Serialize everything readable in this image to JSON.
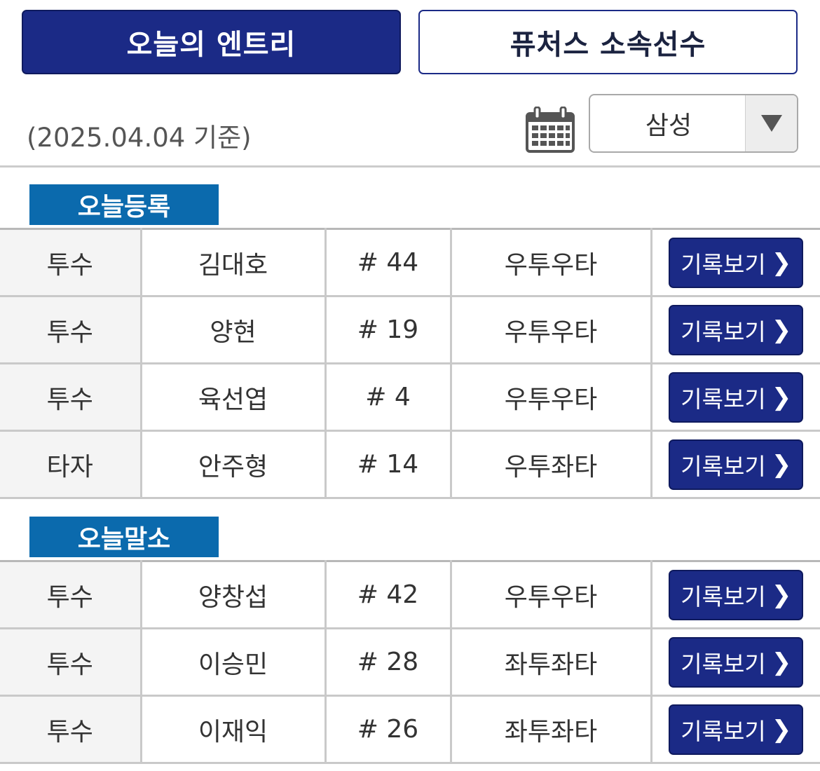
{
  "tabs": [
    {
      "label": "오늘의 엔트리",
      "active": true
    },
    {
      "label": "퓨처스 소속선수",
      "active": false
    }
  ],
  "date_note": "(2025.04.04 기준)",
  "team_select": {
    "value": "삼성"
  },
  "colors": {
    "accent": "#1b2a86",
    "section": "#0b6aad"
  },
  "sections": [
    {
      "title": "오늘등록",
      "rows": [
        {
          "position": "투수",
          "name": "김대호",
          "number": "# 44",
          "hand": "우투우타",
          "button": "기록보기"
        },
        {
          "position": "투수",
          "name": "양현",
          "number": "# 19",
          "hand": "우투우타",
          "button": "기록보기"
        },
        {
          "position": "투수",
          "name": "육선엽",
          "number": "# 4",
          "hand": "우투우타",
          "button": "기록보기"
        },
        {
          "position": "타자",
          "name": "안주형",
          "number": "# 14",
          "hand": "우투좌타",
          "button": "기록보기"
        }
      ]
    },
    {
      "title": "오늘말소",
      "rows": [
        {
          "position": "투수",
          "name": "양창섭",
          "number": "# 42",
          "hand": "우투우타",
          "button": "기록보기"
        },
        {
          "position": "투수",
          "name": "이승민",
          "number": "# 28",
          "hand": "좌투좌타",
          "button": "기록보기"
        },
        {
          "position": "투수",
          "name": "이재익",
          "number": "# 26",
          "hand": "좌투좌타",
          "button": "기록보기"
        }
      ]
    }
  ]
}
